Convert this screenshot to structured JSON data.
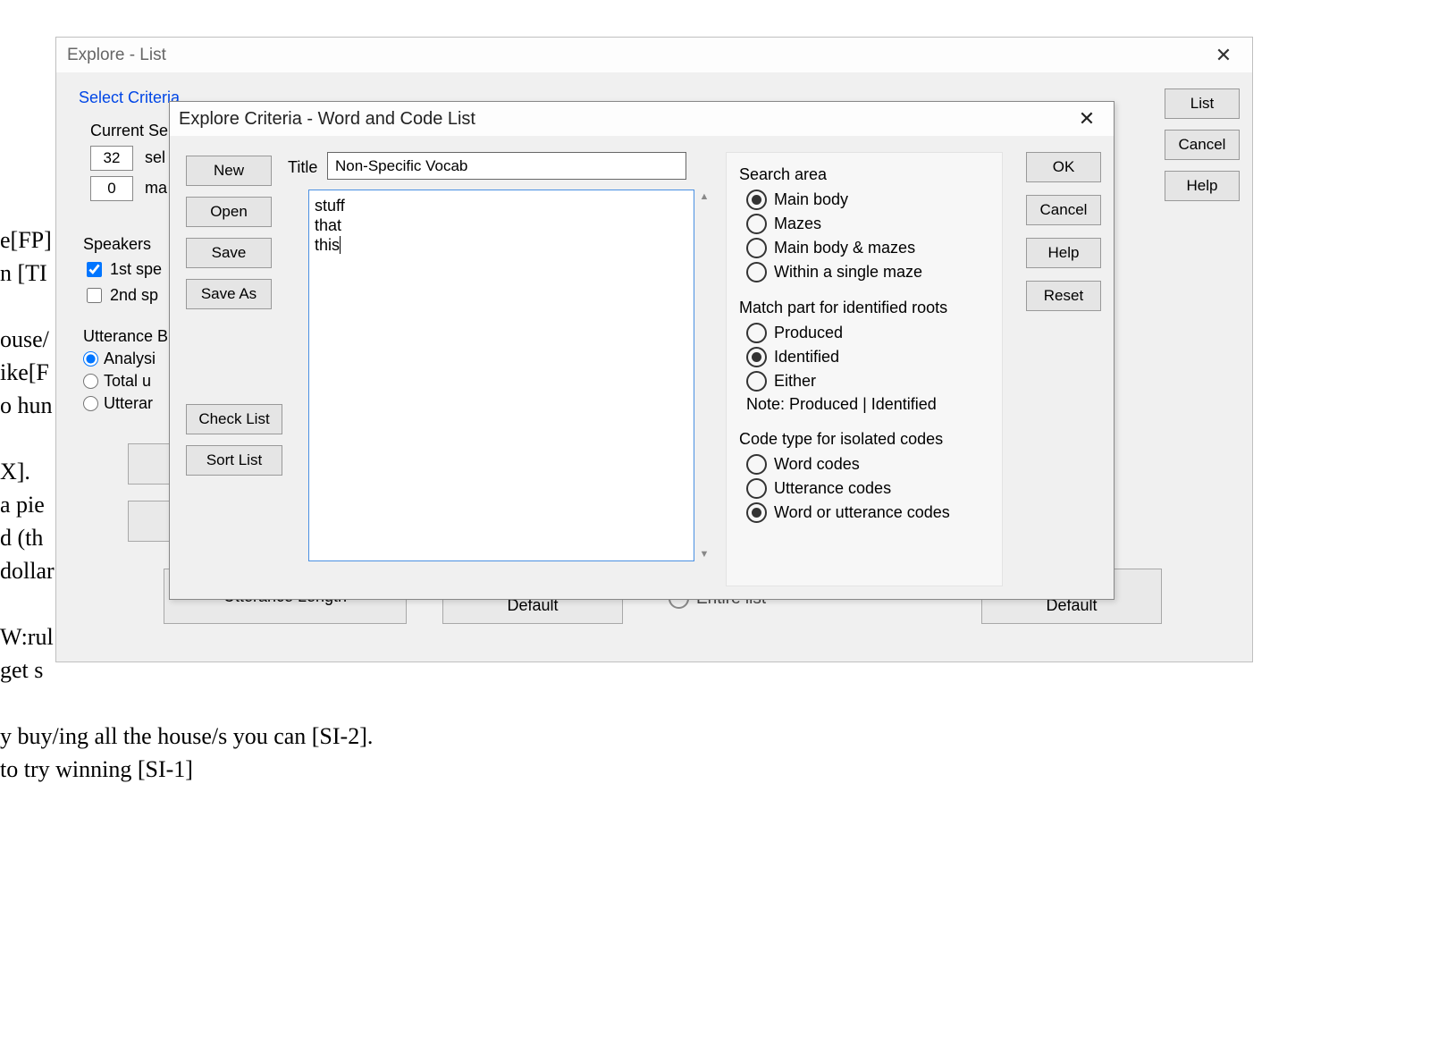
{
  "bg_doc": {
    "lines": [
      "e[FP]",
      "n [TI",
      "",
      "ouse/",
      "ike[F",
      "o hun",
      "",
      "X].",
      "a pie",
      "d (th",
      "dollar",
      "",
      "W:rul",
      "get s",
      "",
      "y buy/ing all the house/s you can [SI-2].",
      "to try winning [SI-1]"
    ]
  },
  "win1": {
    "title": "Explore - List",
    "select_criteria": "Select Criteria",
    "current_selection": "Current Sele",
    "num_selected": "32",
    "sel_label": "sel",
    "num_mat": "0",
    "mat_label": "ma",
    "speakers_label": "Speakers",
    "spk1": "1st spe",
    "spk2": "2nd sp",
    "utt_base": "Utterance B",
    "ub_opts": [
      "Analysi",
      "Total u",
      "Utterar"
    ],
    "utterance_length": "Utterance Length",
    "save_as_default_1": "Save as\nDefault",
    "entire_list": "Entire list",
    "save_as_default_2": "Save as\nDefault",
    "right_buttons": {
      "list": "List",
      "cancel": "Cancel",
      "help": "Help"
    }
  },
  "dlg": {
    "title": "Explore Criteria - Word and Code List",
    "left_buttons": {
      "new": "New",
      "open": "Open",
      "save": "Save",
      "save_as": "Save As",
      "check_list": "Check List",
      "sort_list": "Sort List"
    },
    "title_label": "Title",
    "title_value": "Non-Specific Vocab",
    "list_items": [
      "stuff",
      "that",
      "this"
    ],
    "search_area": {
      "label": "Search area",
      "opts": [
        "Main body",
        "Mazes",
        "Main body & mazes",
        "Within a single maze"
      ],
      "selected": 0
    },
    "match_part": {
      "label": "Match part for identified roots",
      "opts": [
        "Produced",
        "Identified",
        "Either"
      ],
      "selected": 1,
      "note": "Note:  Produced | Identified"
    },
    "code_type": {
      "label": "Code type for isolated codes",
      "opts": [
        "Word codes",
        "Utterance codes",
        "Word or utterance codes"
      ],
      "selected": 2
    },
    "right_buttons": {
      "ok": "OK",
      "cancel": "Cancel",
      "help": "Help",
      "reset": "Reset"
    }
  }
}
